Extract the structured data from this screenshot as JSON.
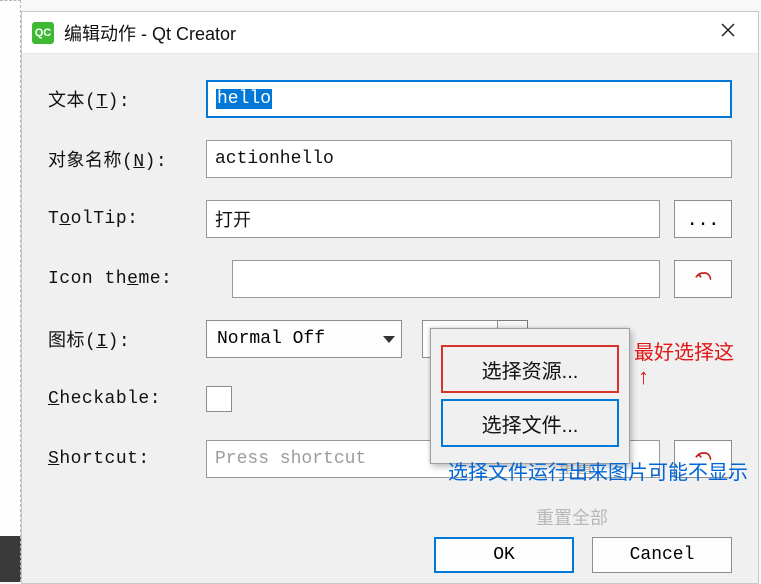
{
  "window": {
    "app_icon_text": "QC",
    "title": "编辑动作 - Qt Creator"
  },
  "labels": {
    "text": "文本(T):",
    "object_name": "对象名称(N):",
    "tooltip": "ToolTip:",
    "icon_theme": "Icon theme:",
    "icon": "图标(I):",
    "checkable": "Checkable:",
    "shortcut": "Shortcut:"
  },
  "fields": {
    "text_value": "hello",
    "object_name_value": "actionhello",
    "tooltip_value": "打开",
    "icon_theme_value": "",
    "icon_combo": "Normal Off",
    "icon_split_label": "...",
    "shortcut_placeholder": "Press shortcut",
    "tooltip_more": "...",
    "checkable_checked": false
  },
  "popup": {
    "item_resource": "选择资源...",
    "item_file": "选择文件..."
  },
  "ghost": {
    "reset": "重置",
    "reset_all": "重置全部"
  },
  "buttons": {
    "ok": "OK",
    "cancel": "Cancel"
  },
  "annotations": {
    "red_text": "最好选择这",
    "red_arrow": "↑",
    "blue_text": "选择文件运行出来图片可能不显示"
  }
}
